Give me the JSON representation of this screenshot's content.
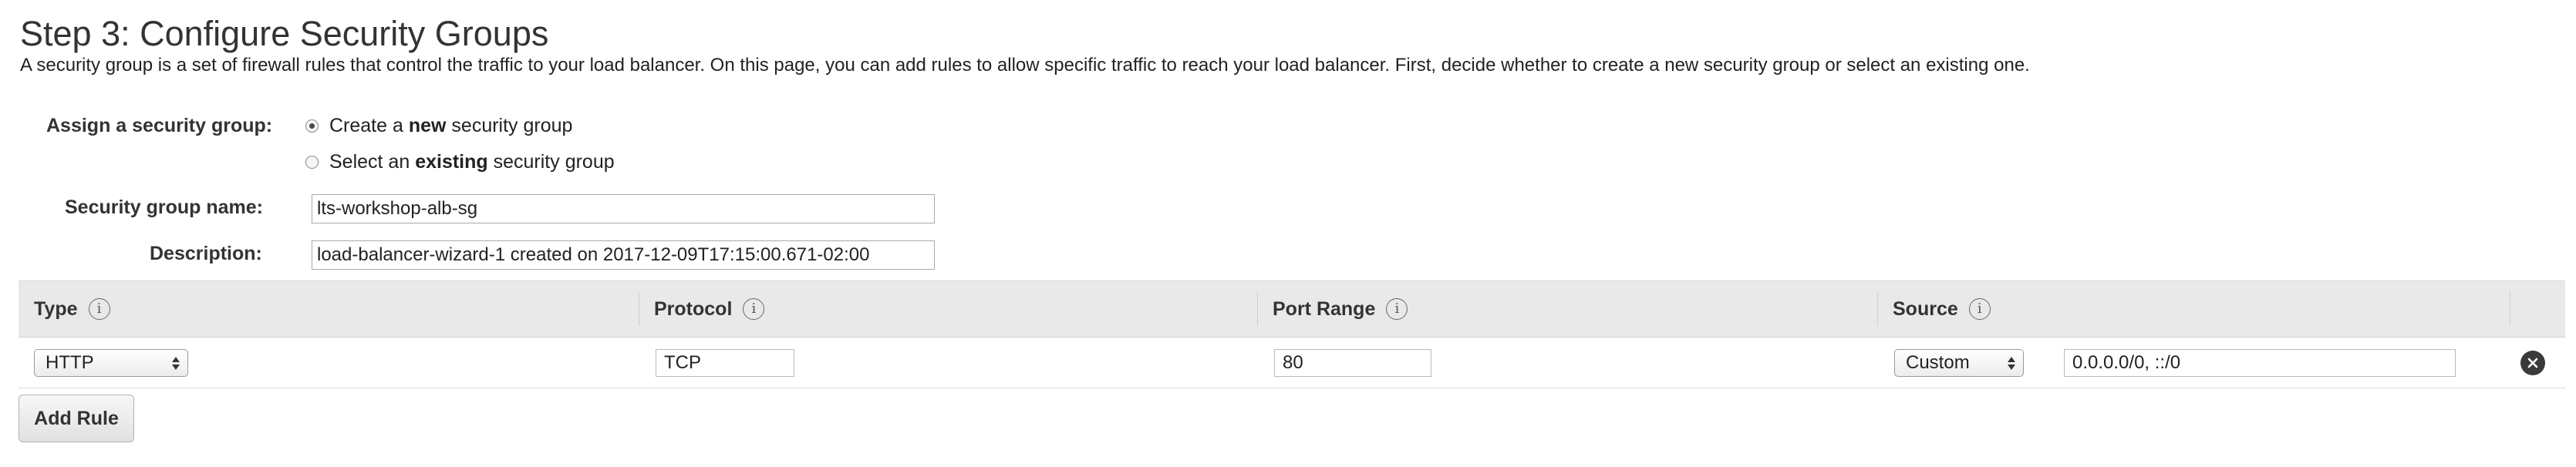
{
  "page": {
    "title": "Step 3: Configure Security Groups",
    "description": "A security group is a set of firewall rules that control the traffic to your load balancer. On this page, you can add rules to allow specific traffic to reach your load balancer. First, decide whether to create a new security group or select an existing one."
  },
  "form": {
    "assign_label": "Assign a security group:",
    "options": [
      {
        "prefix": "Create a ",
        "bold": "new",
        "suffix": " security group",
        "selected": true
      },
      {
        "prefix": "Select an ",
        "bold": "existing",
        "suffix": " security group",
        "selected": false
      }
    ],
    "name_label": "Security group name:",
    "name_value": "lts-workshop-alb-sg",
    "description_label": "Description:",
    "description_value": "load-balancer-wizard-1 created on 2017-12-09T17:15:00.671-02:00"
  },
  "table": {
    "columns": [
      "Type",
      "Protocol",
      "Port Range",
      "Source"
    ],
    "info_icon": "info-icon",
    "rows": [
      {
        "type": "HTTP",
        "protocol": "TCP",
        "port_range": "80",
        "source_mode": "Custom",
        "source_value": "0.0.0.0/0, ::/0"
      }
    ]
  },
  "actions": {
    "add_rule_label": "Add Rule"
  },
  "colors": {
    "header_bg": "#e9e9e9",
    "remove_icon": "#3a3a3a"
  }
}
